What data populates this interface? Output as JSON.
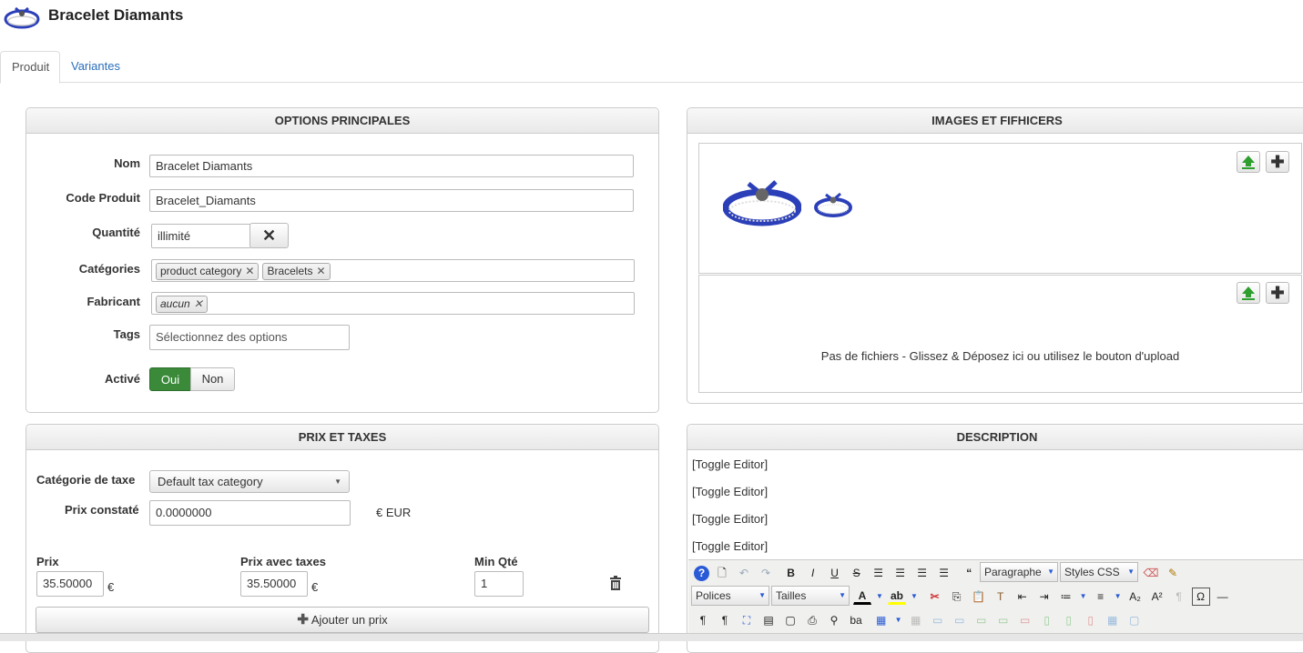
{
  "header": {
    "title": "Bracelet Diamants",
    "logo_icon": "bracelet-thumbnail-icon"
  },
  "tabs": [
    {
      "label": "Produit",
      "active": true
    },
    {
      "label": "Variantes",
      "active": false
    }
  ],
  "main_options": {
    "heading": "OPTIONS PRINCIPALES",
    "name_label": "Nom",
    "name_value": "Bracelet Diamants",
    "code_label": "Code Produit",
    "code_value": "Bracelet_Diamants",
    "qty_label": "Quantité",
    "qty_value": "illimité",
    "categories_label": "Catégories",
    "categories": [
      "product category",
      "Bracelets"
    ],
    "manufacturer_label": "Fabricant",
    "manufacturer": "aucun",
    "tags_label": "Tags",
    "tags_placeholder": "Sélectionnez des options",
    "active_label": "Activé",
    "yes": "Oui",
    "no": "Non"
  },
  "price": {
    "heading": "PRIX ET TAXES",
    "tax_cat_label": "Catégorie de taxe",
    "tax_cat_value": "Default tax category",
    "list_price_label": "Prix constaté",
    "list_price_value": "0.0000000",
    "currency_label": "€ EUR",
    "price_label": "Prix",
    "price_value": "35.50000",
    "euro": "€",
    "price_tax_label": "Prix avec taxes",
    "price_tax_value": "35.50000",
    "min_qty_label": "Min Qté",
    "min_qty_value": "1",
    "add_price": "Ajouter un prix"
  },
  "images": {
    "heading": "IMAGES ET FIFHICERS",
    "no_files": "Pas de fichiers - Glissez & Déposez ici ou utilisez le bouton d'upload"
  },
  "description": {
    "heading": "DESCRIPTION",
    "toggle": "[Toggle Editor]",
    "format_select": "Paragraphe",
    "styles_select": "Styles CSS",
    "fonts_select": "Polices",
    "sizes_select": "Tailles"
  },
  "colors": {
    "active_green": "#3a8a3a",
    "link_blue": "#2a6ebb",
    "bracelet_blue": "#2b3fb8"
  }
}
